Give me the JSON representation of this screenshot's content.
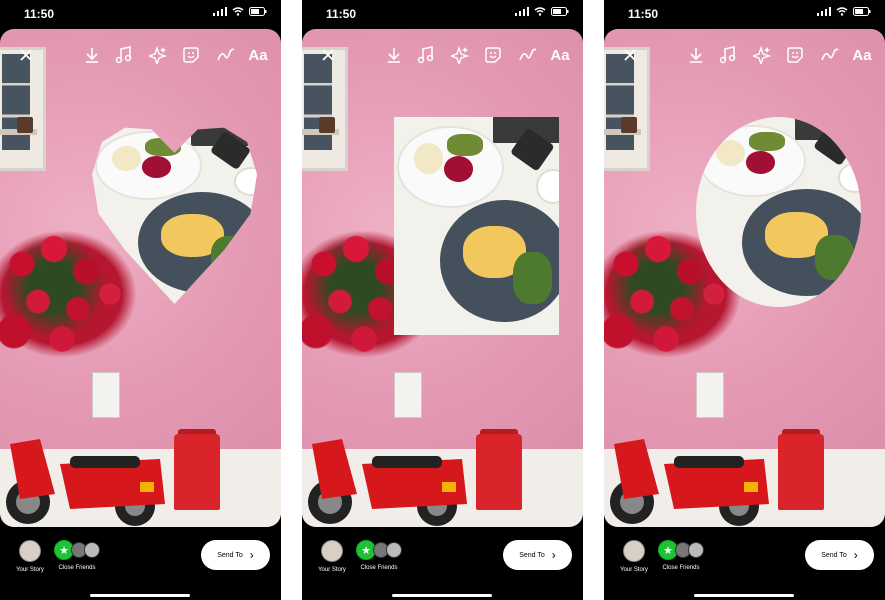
{
  "screens": [
    {
      "time": "11:50",
      "frame_shape": "heart",
      "toolbar": {
        "text_label": "Aa",
        "icons": [
          "close-icon",
          "download-icon",
          "music-icon",
          "effects-icon",
          "sticker-icon",
          "draw-icon"
        ]
      },
      "bottom": {
        "your_story": "Your Story",
        "close_friends": "Close Friends",
        "send_to": "Send To"
      }
    },
    {
      "time": "11:50",
      "frame_shape": "rectangle",
      "toolbar": {
        "text_label": "Aa",
        "icons": [
          "close-icon",
          "download-icon",
          "music-icon",
          "effects-icon",
          "sticker-icon",
          "draw-icon"
        ]
      },
      "bottom": {
        "your_story": "Your Story",
        "close_friends": "Close Friends",
        "send_to": "Send To"
      }
    },
    {
      "time": "11:50",
      "frame_shape": "circle",
      "toolbar": {
        "text_label": "Aa",
        "icons": [
          "close-icon",
          "download-icon",
          "music-icon",
          "effects-icon",
          "sticker-icon",
          "draw-icon"
        ]
      },
      "bottom": {
        "your_story": "Your Story",
        "close_friends": "Close Friends",
        "send_to": "Send To"
      }
    }
  ],
  "colors": {
    "wall_pink": "#e59ab4",
    "close_friends_green": "#1ec334",
    "bin_red": "#d8242a"
  }
}
